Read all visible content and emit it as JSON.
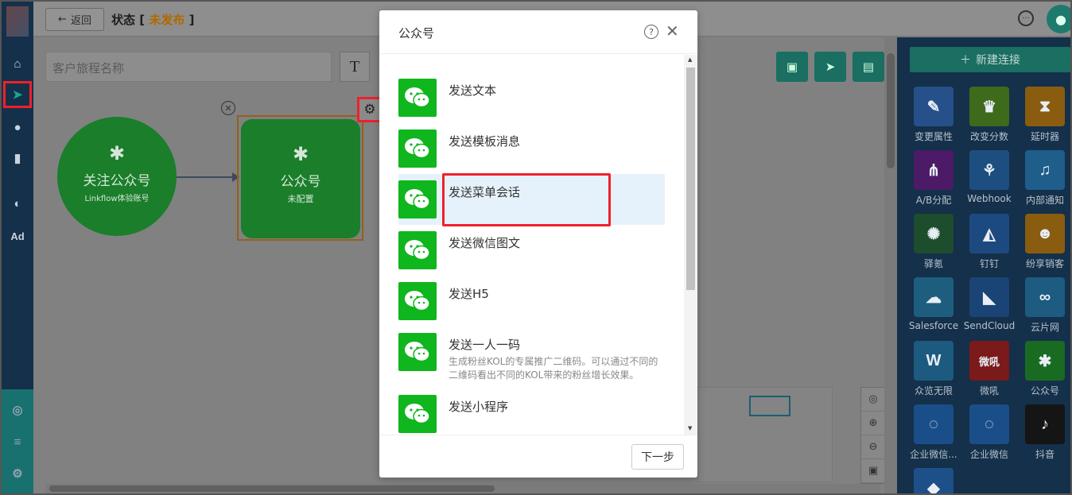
{
  "topbar": {
    "back_label": "返回",
    "status_label": "状态 [",
    "status_value": "未发布",
    "status_close": "]"
  },
  "canvas": {
    "name_placeholder": "客户旅程名称",
    "text_tool": "T",
    "start_node": {
      "title": "关注公众号",
      "subtitle": "Linkflow体验账号"
    },
    "action_node": {
      "title": "公众号",
      "subtitle": "未配置"
    }
  },
  "right_panel": {
    "new_connection": "新建连接",
    "tiles": [
      {
        "label": "变更属性",
        "icon": "edit-icon",
        "color": "#26508a"
      },
      {
        "label": "改变分数",
        "icon": "trophy-icon",
        "color": "#3e6a1c"
      },
      {
        "label": "延时器",
        "icon": "hourglass-icon",
        "color": "#8a5c10"
      },
      {
        "label": "A/B分配",
        "icon": "ab-split-icon",
        "color": "#4c1a66"
      },
      {
        "label": "Webhook",
        "icon": "webhook-icon",
        "color": "#1c4f80"
      },
      {
        "label": "内部通知",
        "icon": "bell-icon",
        "color": "#1f5d8a"
      },
      {
        "label": "驿氪",
        "icon": "yike-icon",
        "color": "#1d4d2c"
      },
      {
        "label": "钉钉",
        "icon": "dingtalk-icon",
        "color": "#1c4a80"
      },
      {
        "label": "纷享销客",
        "icon": "fxiaoke-icon",
        "color": "#8a5c10"
      },
      {
        "label": "Salesforce",
        "icon": "salesforce-icon",
        "color": "#1d5e7e"
      },
      {
        "label": "SendCloud",
        "icon": "sendcloud-icon",
        "color": "#1a4475"
      },
      {
        "label": "云片网",
        "icon": "yunpian-icon",
        "color": "#1d5b80"
      },
      {
        "label": "众览无限",
        "icon": "webull-icon",
        "color": "#1d5a80"
      },
      {
        "label": "微吼",
        "icon": "vhall-icon",
        "color": "#7a1a1a"
      },
      {
        "label": "公众号",
        "icon": "wechat-icon",
        "color": "#1a6b22"
      },
      {
        "label": "企业微信...",
        "icon": "wecom-icon",
        "color": "#1a4e88"
      },
      {
        "label": "企业微信",
        "icon": "wecom-icon",
        "color": "#1a4e88"
      },
      {
        "label": "抖音",
        "icon": "douyin-icon",
        "color": "#151515"
      }
    ]
  },
  "modal": {
    "title": "公众号",
    "items": [
      {
        "name": "发送文本",
        "desc": ""
      },
      {
        "name": "发送模板消息",
        "desc": ""
      },
      {
        "name": "发送菜单会话",
        "desc": ""
      },
      {
        "name": "发送微信图文",
        "desc": ""
      },
      {
        "name": "发送H5",
        "desc": ""
      },
      {
        "name": "发送一人一码",
        "desc": "生成粉丝KOL的专属推广二维码。可以通过不同的二维码看出不同的KOL带来的粉丝增长效果。"
      },
      {
        "name": "发送小程序",
        "desc": ""
      }
    ],
    "next_label": "下一步"
  }
}
